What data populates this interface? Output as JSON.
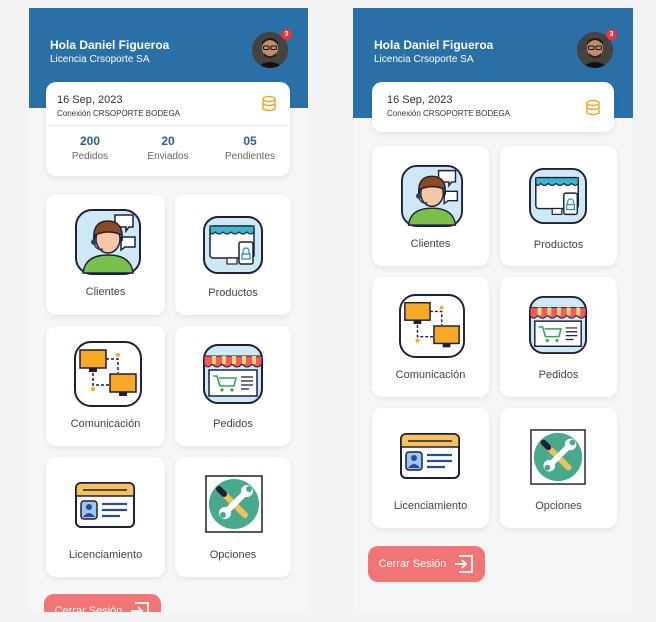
{
  "user": {
    "greeting": "Hola Daniel Figueroa",
    "license": "Licencia Crsoporte SA",
    "notifications": "3"
  },
  "info": {
    "date": "16 Sep, 2023",
    "connection": "Conexión CRSOPORTE BODEGA"
  },
  "stats": [
    {
      "value": "200",
      "label": "Pedidos"
    },
    {
      "value": "20",
      "label": "Enviados"
    },
    {
      "value": "05",
      "label": "Pendientes"
    }
  ],
  "menu": [
    {
      "label": "Clientes",
      "icon": "customer-support-icon"
    },
    {
      "label": "Productos",
      "icon": "online-store-icon"
    },
    {
      "label": "Comunicación",
      "icon": "network-computers-icon"
    },
    {
      "label": "Pedidos",
      "icon": "shop-cart-icon"
    },
    {
      "label": "Licenciamiento",
      "icon": "id-card-icon"
    },
    {
      "label": "Opciones",
      "icon": "tools-icon"
    }
  ],
  "logout_label": "Cerrar Sesión",
  "colors": {
    "header": "#2a70a6",
    "logout": "#f27575",
    "stat_number": "#2a5f8f"
  }
}
